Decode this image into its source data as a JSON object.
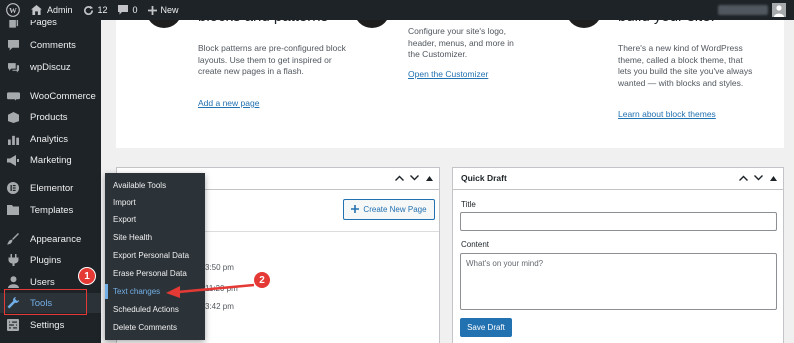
{
  "adminbar": {
    "site_name": "Admin",
    "updates_count": "12",
    "comments_count": "0",
    "new_label": "New"
  },
  "sidebar": {
    "items": [
      {
        "label": "Pages",
        "icon": "pages-icon"
      },
      {
        "label": "Comments",
        "icon": "comments-icon"
      },
      {
        "label": "wpDiscuz",
        "icon": "wpdiscuz-icon"
      },
      {
        "label": "WooCommerce",
        "icon": "woocommerce-icon"
      },
      {
        "label": "Products",
        "icon": "products-icon"
      },
      {
        "label": "Analytics",
        "icon": "analytics-icon"
      },
      {
        "label": "Marketing",
        "icon": "marketing-icon"
      },
      {
        "label": "Elementor",
        "icon": "elementor-icon"
      },
      {
        "label": "Templates",
        "icon": "templates-icon"
      },
      {
        "label": "Appearance",
        "icon": "appearance-icon"
      },
      {
        "label": "Plugins",
        "icon": "plugins-icon"
      },
      {
        "label": "Users",
        "icon": "users-icon"
      },
      {
        "label": "Tools",
        "icon": "tools-icon"
      },
      {
        "label": "Settings",
        "icon": "settings-icon"
      }
    ]
  },
  "tools_submenu": {
    "items": [
      "Available Tools",
      "Import",
      "Export",
      "Site Health",
      "Export Personal Data",
      "Erase Personal Data",
      "Text changes",
      "Scheduled Actions",
      "Delete Comments"
    ]
  },
  "welcome": {
    "col1": {
      "title": "blocks and patterns",
      "text": "Block patterns are pre-configured block layouts. Use them to get inspired or create new pages in a flash.",
      "link": "Add a new page"
    },
    "col2": {
      "text": "Configure your site's logo, header, menus, and more in the Customizer.",
      "link": "Open the Customizer"
    },
    "col3": {
      "title": "build your site.",
      "text": "There's a new kind of WordPress theme, called a block theme, that lets you build the site you've always wanted — with blocks and styles.",
      "link": "Learn about block themes"
    }
  },
  "activity": {
    "create_button": "Create New Page",
    "times": [
      "3:50 pm",
      "11:20 pm",
      "3:42 pm"
    ]
  },
  "quick_draft": {
    "title": "Quick Draft",
    "title_label": "Title",
    "content_label": "Content",
    "content_placeholder": "What's on your mind?",
    "save_button": "Save Draft"
  },
  "annotations": {
    "badge_1": "1",
    "badge_2": "2"
  },
  "colors": {
    "adminbar_bg": "#1d2327",
    "accent_blue": "#2271b1",
    "highlight_blue": "#72aee6",
    "annotation_red": "#e53935"
  }
}
